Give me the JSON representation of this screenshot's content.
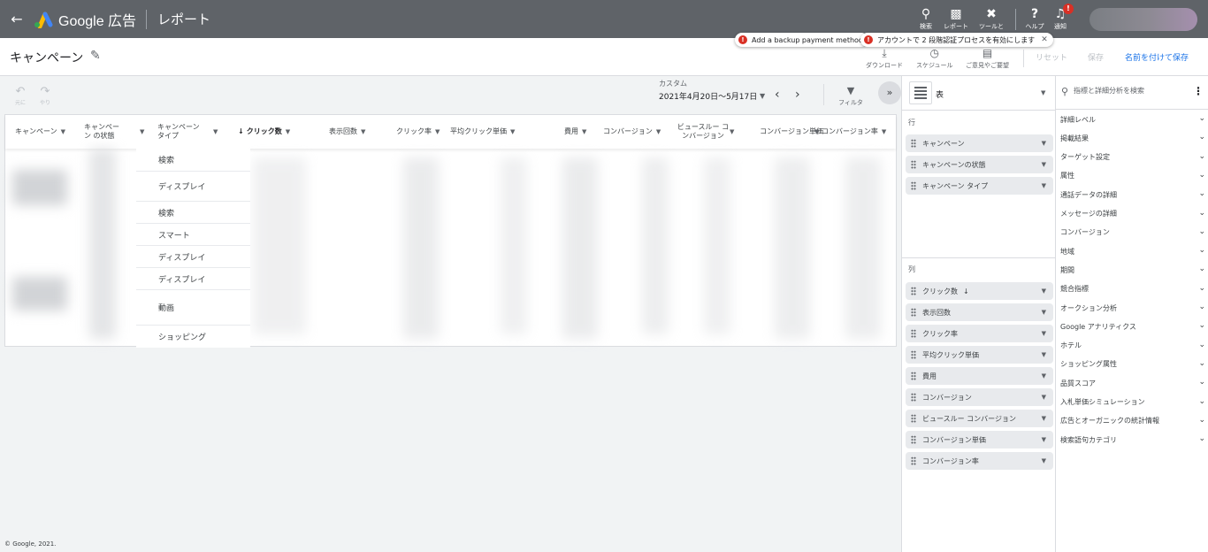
{
  "topbar": {
    "brand": "Google 広告",
    "title": "レポート",
    "actions": [
      {
        "label": "検索",
        "icon": "search-icon"
      },
      {
        "label": "レポート",
        "icon": "reports-icon"
      },
      {
        "label": "ツールと",
        "icon": "wrench-icon"
      },
      {
        "label": "ヘルプ",
        "icon": "help-icon"
      },
      {
        "label": "通知",
        "icon": "bell-icon"
      }
    ],
    "notification_badge": "!"
  },
  "header": {
    "title": "キャンペーン",
    "actions": [
      {
        "label": "ダウンロード",
        "icon": "download-icon"
      },
      {
        "label": "スケジュール",
        "icon": "clock-icon"
      },
      {
        "label": "ご意見やご要望",
        "icon": "feedback-icon"
      }
    ],
    "reset": "リセット",
    "save": "保存",
    "save_as": "名前を付けて保存"
  },
  "notifications": [
    {
      "text": "Add a backup payment method"
    },
    {
      "text": "アカウントで 2 段階認証プロセスを有効にします"
    }
  ],
  "toolbar": {
    "undo": "元に",
    "redo": "やり",
    "date_label": "カスタム",
    "date_range": "2021年4月20日～5月17日",
    "filter": "フィルタ"
  },
  "table": {
    "headers": [
      {
        "label": "キャンペーン"
      },
      {
        "label": "キャンペーン の状態"
      },
      {
        "label": "キャンペーン タイプ"
      },
      {
        "label": "クリック数"
      },
      {
        "label": "表示回数"
      },
      {
        "label": "クリック率"
      },
      {
        "label": "平均クリック単価"
      },
      {
        "label": "費用"
      },
      {
        "label": "コンバージョン"
      },
      {
        "label": "ビュースルー コンバージョン"
      },
      {
        "label": "コンバージョン単価"
      },
      {
        "label": "コンバージョン率"
      }
    ],
    "campaign_types": [
      "検索",
      "ディスプレイ",
      "検索",
      "スマート",
      "ディスプレイ",
      "ディスプレイ",
      "動画",
      "ショッピング"
    ]
  },
  "footer": {
    "copyright": "© Google, 2021."
  },
  "editor": {
    "visualization": "表",
    "rows_label": "行",
    "rows": [
      "キャンペーン",
      "キャンペーンの状態",
      "キャンペーン タイプ"
    ],
    "columns_label": "列",
    "columns": [
      "クリック数",
      "表示回数",
      "クリック率",
      "平均クリック単価",
      "費用",
      "コンバージョン",
      "ビュースルー コンバージョン",
      "コンバージョン単価",
      "コンバージョン率"
    ]
  },
  "metrics_panel": {
    "search_placeholder": "指標と詳細分析を検索",
    "categories": [
      "詳細レベル",
      "掲載結果",
      "ターゲット設定",
      "属性",
      "通話データの詳細",
      "メッセージの詳細",
      "コンバージョン",
      "地域",
      "期間",
      "競合指標",
      "オークション分析",
      "Google アナリティクス",
      "ホテル",
      "ショッピング属性",
      "品質スコア",
      "入札単価シミュレーション",
      "広告とオーガニックの統計情報",
      "検索語句カテゴリ"
    ]
  },
  "colors": {
    "topbar": "#5f6368",
    "accent_blue": "#1a73e8",
    "error_red": "#d93025"
  }
}
